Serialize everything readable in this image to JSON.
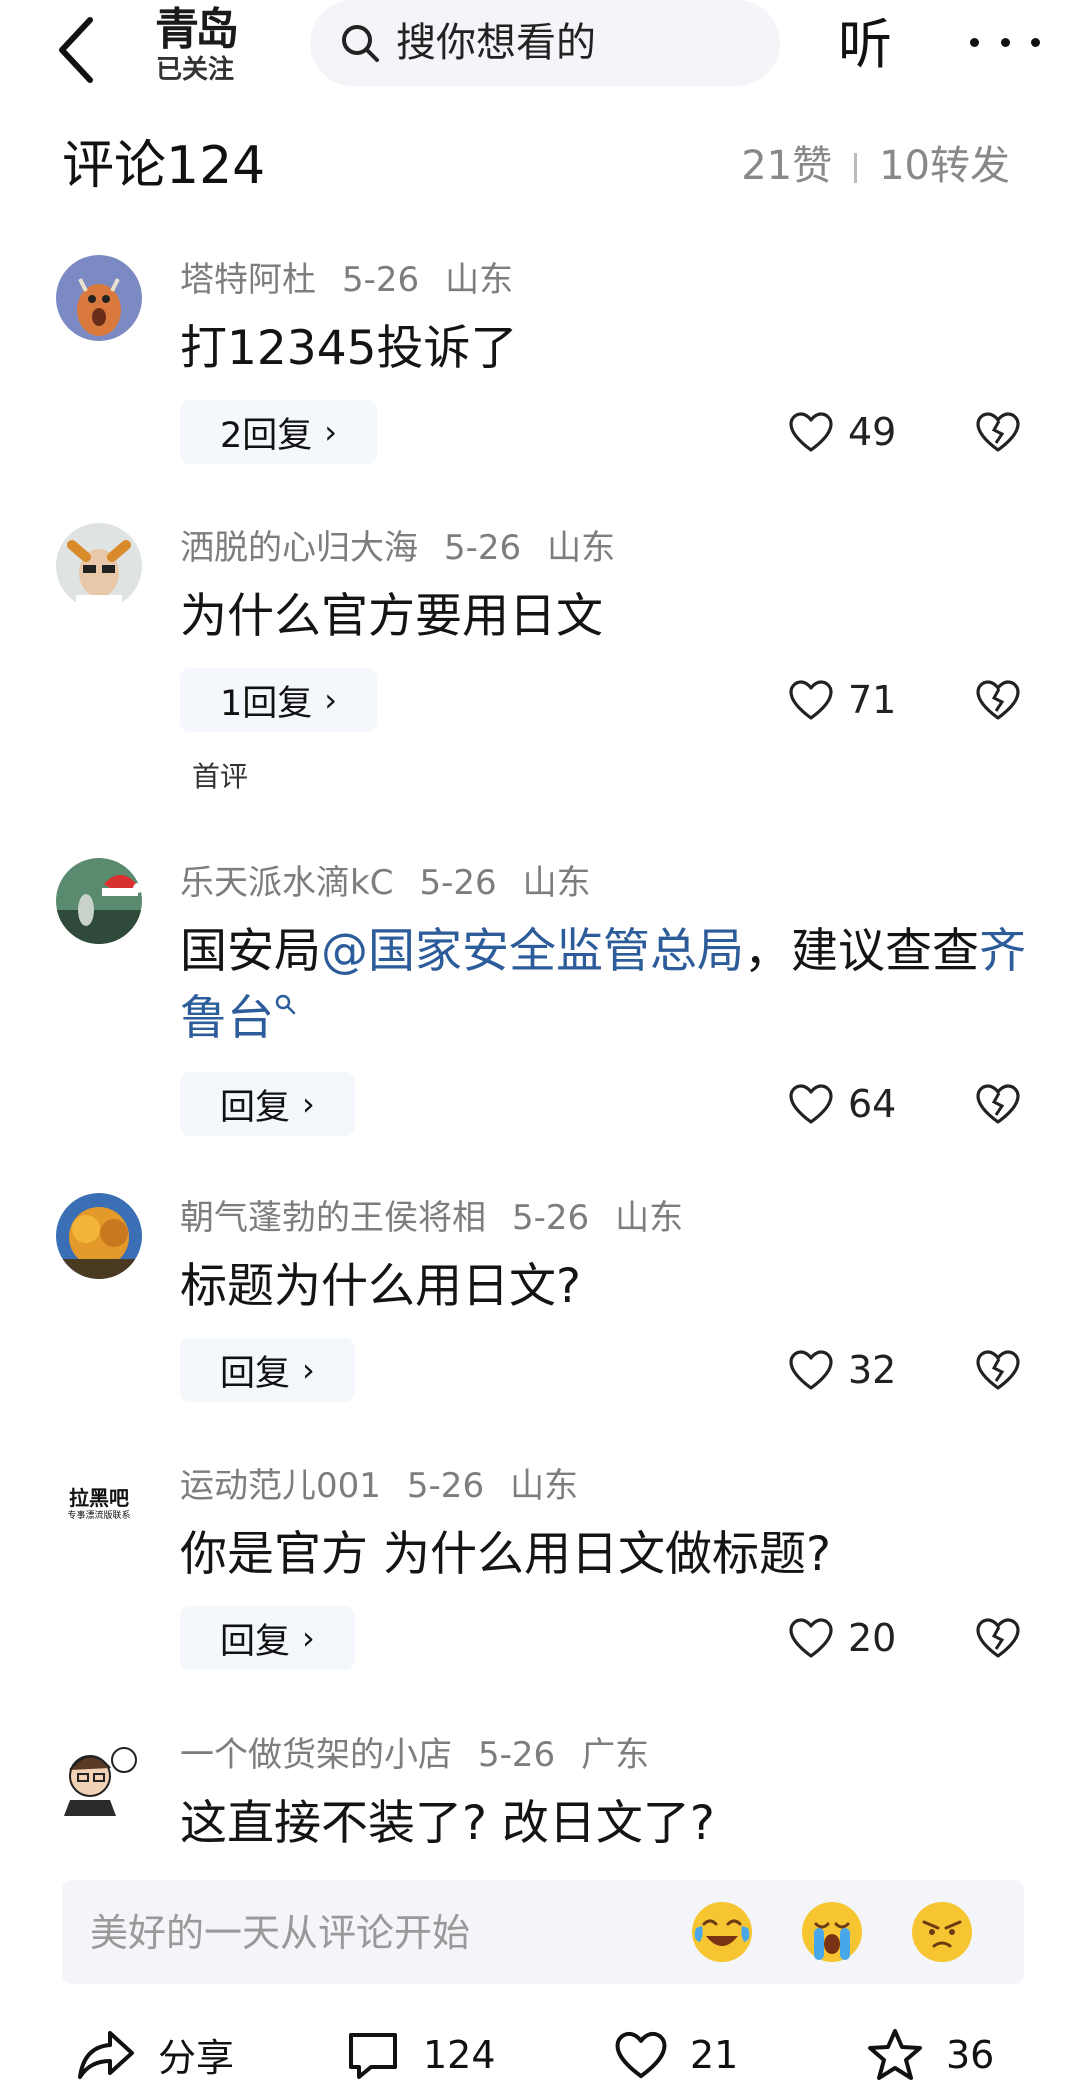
{
  "topbar": {
    "logo": "青岛",
    "followed_label": "已关注",
    "search_placeholder": "搜你想看的",
    "listen_label": "听"
  },
  "comments_header": {
    "title": "评论124",
    "likes": "21赞",
    "shares": "10转发"
  },
  "comments": [
    {
      "user": "塔特阿杜",
      "date": "5-26",
      "location": "山东",
      "text": "打12345投诉了",
      "reply_label": "2回复",
      "likes": "49"
    },
    {
      "user": "洒脱的心归大海",
      "date": "5-26",
      "location": "山东",
      "text": "为什么官方要用日文",
      "reply_label": "1回复",
      "likes": "71",
      "tag": "首评"
    },
    {
      "user": "乐天派水滴kC",
      "date": "5-26",
      "location": "山东",
      "text_prefix": "国安局",
      "mention": "@国家安全监管总局",
      "text_middle": "，建议查查",
      "link": "齐鲁台",
      "reply_label": "回复",
      "likes": "64"
    },
    {
      "user": "朝气蓬勃的王侯将相",
      "date": "5-26",
      "location": "山东",
      "text": "标题为什么用日文?",
      "reply_label": "回复",
      "likes": "32"
    },
    {
      "user": "运动范儿001",
      "date": "5-26",
      "location": "山东",
      "avatar_text": "拉黑吧",
      "avatar_subtext": "专事漂流版联系",
      "text": "你是官方 为什么用日文做标题?",
      "reply_label": "回复",
      "likes": "20"
    },
    {
      "user": "一个做货架的小店",
      "date": "5-26",
      "location": "广东",
      "text": "这直接不装了? 改日文了?"
    }
  ],
  "input_bar": {
    "placeholder": "美好的一天从评论开始",
    "emojis": [
      "laughing-crying-emoji",
      "crying-emoji",
      "annoyed-emoji"
    ]
  },
  "bottom_bar": {
    "share_label": "分享",
    "comment_count": "124",
    "like_count": "21",
    "favorite_count": "36"
  },
  "colors": {
    "link": "#2d5c9a",
    "meta": "#7d7d7d",
    "pill_bg": "#f4f7fc"
  }
}
